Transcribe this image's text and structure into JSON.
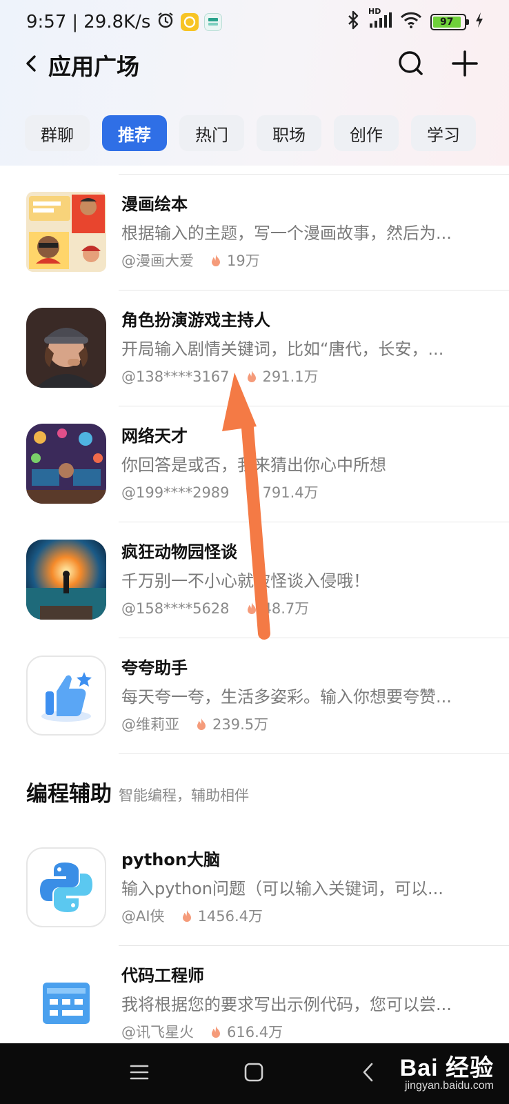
{
  "status_bar": {
    "time": "9:57",
    "network_speed": "29.8K/s",
    "battery": "97",
    "icons": [
      "alarm-icon",
      "app-notify-icon",
      "app-notify-icon",
      "bluetooth-icon",
      "signal-icon",
      "wifi-icon",
      "battery-icon",
      "charging-icon"
    ],
    "signal_label": "HD"
  },
  "header": {
    "title": "应用广场",
    "icons": [
      "back-icon",
      "search-icon",
      "plus-icon"
    ]
  },
  "tabs": [
    {
      "label": "群聊",
      "active": false
    },
    {
      "label": "推荐",
      "active": true
    },
    {
      "label": "热门",
      "active": false
    },
    {
      "label": "职场",
      "active": false
    },
    {
      "label": "创作",
      "active": false
    },
    {
      "label": "学习",
      "active": false
    }
  ],
  "recommend_items": [
    {
      "title": "漫画绘本",
      "desc": "根据输入的主题，写一个漫画故事，然后为...",
      "author": "@漫画大爱",
      "heat": "19万"
    },
    {
      "title": "角色扮演游戏主持人",
      "desc": "开局输入剧情关键词，比如“唐代，长安，...",
      "author": "@138****3167",
      "heat": "291.1万"
    },
    {
      "title": "网络天才",
      "desc": "你回答是或否，我来猜出你心中所想",
      "author": "@199****2989",
      "heat": "791.4万"
    },
    {
      "title": "疯狂动物园怪谈",
      "desc": "千万别一不小心就被怪谈入侵哦！",
      "author": "@158****5628",
      "heat": "48.7万"
    },
    {
      "title": "夸夸助手",
      "desc": "每天夸一夸，生活多姿彩。输入你想要夸赞...",
      "author": "@维莉亚",
      "heat": "239.5万"
    }
  ],
  "section": {
    "title": "编程辅助",
    "subtitle": "智能编程，辅助相伴"
  },
  "coding_items": [
    {
      "title": "python大脑",
      "desc": "输入python问题（可以输入关键词，可以...",
      "author": "@AI侠",
      "heat": "1456.4万"
    },
    {
      "title": "代码工程师",
      "desc": "我将根据您的要求写出示例代码，您可以尝...",
      "author": "@讯飞星火",
      "heat": "616.4万"
    }
  ],
  "nav_bar": {
    "icons": [
      "menu-icon",
      "home-icon",
      "back-icon"
    ]
  },
  "watermark": {
    "main": "Bai 经验",
    "sub": "jingyan.baidu.com"
  },
  "colors": {
    "accent": "#2f6fe6",
    "flame": "#f59b7a",
    "annotation_arrow": "#f47a45"
  }
}
